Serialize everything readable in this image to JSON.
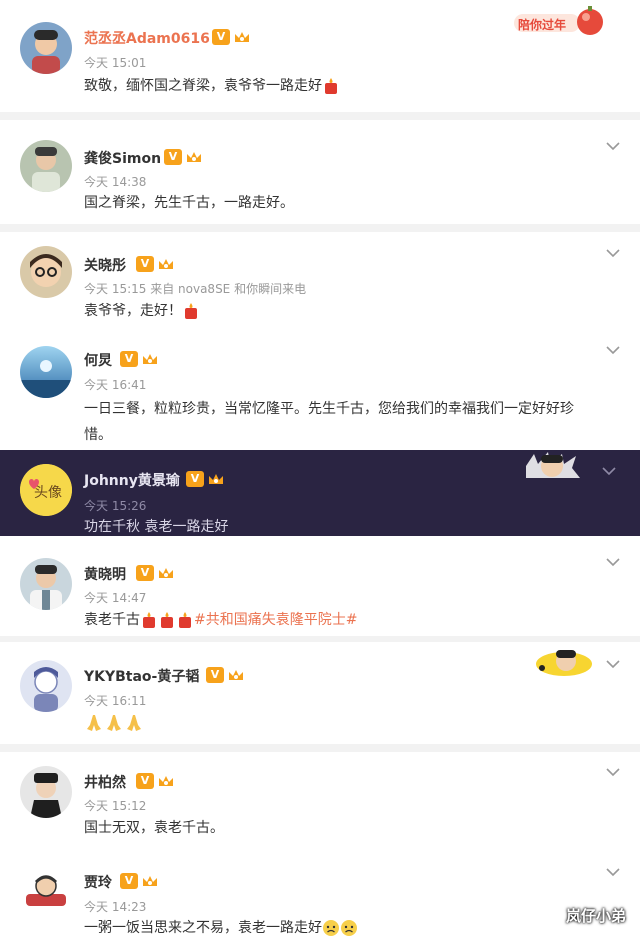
{
  "holiday_badge": "陪你过年",
  "comments": [
    {
      "user": "范丞丞Adam0616",
      "time": "今天 15:01",
      "text": "致敬，缅怀国之脊梁，袁爷爷一路走好"
    },
    {
      "user": "龚俊Simon",
      "time": "今天 14:38",
      "text": "国之脊梁，先生千古，一路走好。"
    },
    {
      "user": "关晓彤",
      "time": "今天 15:15 来自 nova8SE 和你瞬间来电",
      "text": "袁爷爷，走好！"
    },
    {
      "user": "何炅",
      "time": "今天 16:41",
      "text_line1": "一日三餐，粒粒珍贵，当常忆隆平。先生千古，您给我们的幸福我们一定好好珍",
      "text_line2": "惜。"
    },
    {
      "user": "Johnny黄景瑜",
      "avatar_text": "头像",
      "time": "今天 15:26",
      "text": "功在千秋 袁老一路走好"
    },
    {
      "user": "黄晓明",
      "time": "今天 14:47",
      "text": "袁老千古",
      "tag": "#共和国痛失袁隆平院士#"
    },
    {
      "user": "YKYBtao-黄子韬",
      "time": "今天 16:11",
      "text": "🙏🙏🙏"
    },
    {
      "user": "井柏然",
      "time": "今天 15:12",
      "text": "国士无双，袁老千古。"
    },
    {
      "user": "贾玲",
      "time": "今天 14:23",
      "text": "一粥一饭当思来之不易，袁老一路走好"
    }
  ],
  "verified_mark": "V",
  "watermark": "岚仔小弟",
  "colors": {
    "accent": "#eb7350",
    "badge": "#f7a21b",
    "dark_bg": "#2a2442"
  },
  "icons": [
    "chevron-down-icon",
    "verified-icon",
    "crown-icon",
    "candle-emoji",
    "pray-emoji",
    "sad-emoji"
  ]
}
